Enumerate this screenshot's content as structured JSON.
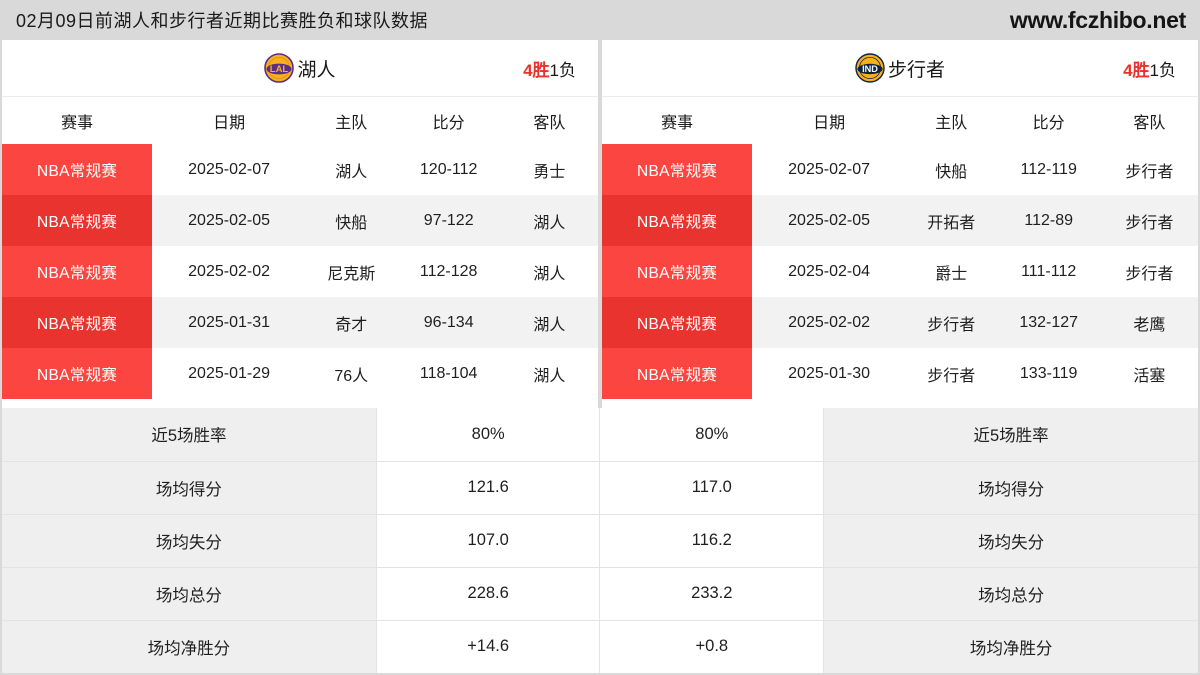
{
  "header": {
    "title": "02月09日前湖人和步行者近期比赛胜负和球队数据",
    "site": "www.fczhibo.net"
  },
  "colors": {
    "accent_red": "#fb4540",
    "accent_red_dark": "#e8332f",
    "win_red": "#e8312b",
    "page_bg": "#d9d9d9",
    "row_alt": "#f2f2f2",
    "label_bg": "#efefef"
  },
  "columns": {
    "league": "赛事",
    "date": "日期",
    "home": "主队",
    "score": "比分",
    "away": "客队"
  },
  "left": {
    "team_name": "湖人",
    "logo_text": "LAL",
    "logo_icon": "lakers-logo-icon",
    "record_win": "4胜",
    "record_loss": "1负",
    "games": [
      {
        "league": "NBA常规赛",
        "date": "2025-02-07",
        "home": "湖人",
        "score": "120-112",
        "away": "勇士"
      },
      {
        "league": "NBA常规赛",
        "date": "2025-02-05",
        "home": "快船",
        "score": "97-122",
        "away": "湖人"
      },
      {
        "league": "NBA常规赛",
        "date": "2025-02-02",
        "home": "尼克斯",
        "score": "112-128",
        "away": "湖人"
      },
      {
        "league": "NBA常规赛",
        "date": "2025-01-31",
        "home": "奇才",
        "score": "96-134",
        "away": "湖人"
      },
      {
        "league": "NBA常规赛",
        "date": "2025-01-29",
        "home": "76人",
        "score": "118-104",
        "away": "湖人"
      }
    ]
  },
  "right": {
    "team_name": "步行者",
    "logo_text": "IND",
    "logo_icon": "pacers-logo-icon",
    "record_win": "4胜",
    "record_loss": "1负",
    "games": [
      {
        "league": "NBA常规赛",
        "date": "2025-02-07",
        "home": "快船",
        "score": "112-119",
        "away": "步行者"
      },
      {
        "league": "NBA常规赛",
        "date": "2025-02-05",
        "home": "开拓者",
        "score": "112-89",
        "away": "步行者"
      },
      {
        "league": "NBA常规赛",
        "date": "2025-02-04",
        "home": "爵士",
        "score": "111-112",
        "away": "步行者"
      },
      {
        "league": "NBA常规赛",
        "date": "2025-02-02",
        "home": "步行者",
        "score": "132-127",
        "away": "老鹰"
      },
      {
        "league": "NBA常规赛",
        "date": "2025-01-30",
        "home": "步行者",
        "score": "133-119",
        "away": "活塞"
      }
    ]
  },
  "stats": [
    {
      "label_left": "近5场胜率",
      "value_left": "80%",
      "value_right": "80%",
      "label_right": "近5场胜率"
    },
    {
      "label_left": "场均得分",
      "value_left": "121.6",
      "value_right": "117.0",
      "label_right": "场均得分"
    },
    {
      "label_left": "场均失分",
      "value_left": "107.0",
      "value_right": "116.2",
      "label_right": "场均失分"
    },
    {
      "label_left": "场均总分",
      "value_left": "228.6",
      "value_right": "233.2",
      "label_right": "场均总分"
    },
    {
      "label_left": "场均净胜分",
      "value_left": "+14.6",
      "value_right": "+0.8",
      "label_right": "场均净胜分"
    }
  ]
}
